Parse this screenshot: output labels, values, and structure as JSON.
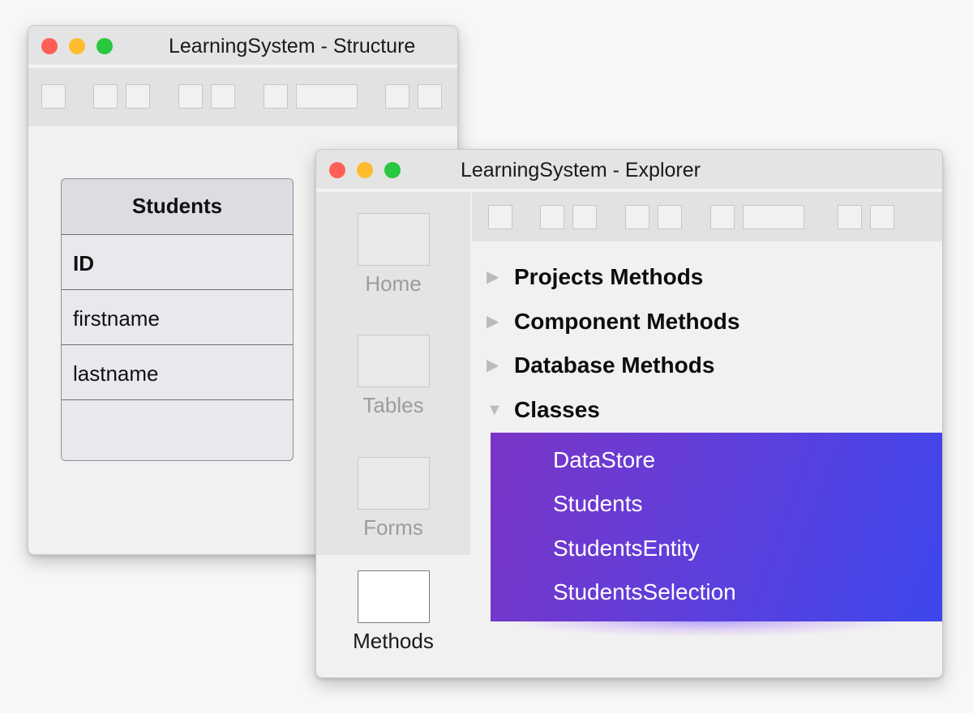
{
  "structure_window": {
    "title": "LearningSystem - Structure",
    "table": {
      "name": "Students",
      "fields": [
        "ID",
        "firstname",
        "lastname",
        ""
      ]
    }
  },
  "explorer_window": {
    "title": "LearningSystem - Explorer",
    "sidebar": {
      "items": [
        {
          "label": "Home",
          "icon": "home-icon"
        },
        {
          "label": "Tables",
          "icon": "tables-icon"
        },
        {
          "label": "Forms",
          "icon": "forms-icon"
        },
        {
          "label": "Methods",
          "icon": "methods-icon",
          "active": true
        }
      ]
    },
    "tree": {
      "groups": [
        {
          "label": "Projects Methods",
          "state": "collapsed"
        },
        {
          "label": "Component Methods",
          "state": "collapsed"
        },
        {
          "label": "Database Methods",
          "state": "collapsed"
        },
        {
          "label": "Classes",
          "state": "expanded"
        }
      ],
      "classes": [
        "DataStore",
        "Students",
        "StudentsEntity",
        "StudentsSelection"
      ]
    }
  },
  "colors": {
    "traffic_close": "#fe5f57",
    "traffic_minimize": "#febc2e",
    "traffic_maximize": "#28c840",
    "selection_gradient_start": "#7b35c6",
    "selection_gradient_end": "#3d47ec"
  }
}
